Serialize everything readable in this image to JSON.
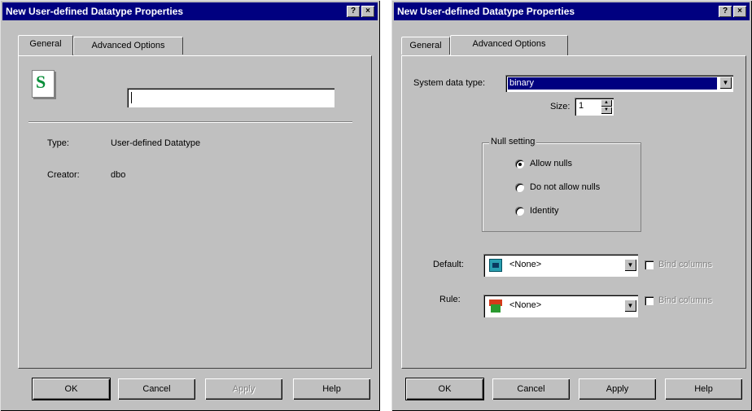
{
  "dialog1": {
    "title": "New User-defined Datatype Properties",
    "tabs": [
      "General",
      "Advanced Options"
    ],
    "icon_letter": "S",
    "name_value": "",
    "type_label": "Type:",
    "type_value": "User-defined Datatype",
    "creator_label": "Creator:",
    "creator_value": "dbo",
    "buttons": {
      "ok": "OK",
      "cancel": "Cancel",
      "apply": "Apply",
      "help": "Help"
    }
  },
  "dialog2": {
    "title": "New User-defined Datatype Properties",
    "tabs": [
      "General",
      "Advanced Options"
    ],
    "system_type_label": "System data type:",
    "system_type_value": "binary",
    "size_label": "Size:",
    "size_value": "1",
    "null_group_label": "Null setting",
    "null_options": [
      "Allow nulls",
      "Do not allow nulls",
      "Identity"
    ],
    "default_label": "Default:",
    "default_value": "<None>",
    "default_check_label": "Bind columns",
    "rule_label": "Rule:",
    "rule_value": "<None>",
    "rule_check_label": "Bind columns",
    "buttons": {
      "ok": "OK",
      "cancel": "Cancel",
      "apply": "Apply",
      "help": "Help"
    }
  },
  "titlebar_buttons": {
    "help": "?",
    "close": "×"
  },
  "colors": {
    "titlebar": "#000080",
    "face": "#c0c0c0",
    "selection": "#000080",
    "icon_green": "#0a8f3a"
  },
  "icons": [
    "help-icon",
    "close-icon",
    "datatype-s-icon",
    "spin-up-icon",
    "spin-down-icon",
    "dropdown-arrow-icon",
    "default-object-icon",
    "rule-object-icon"
  ]
}
